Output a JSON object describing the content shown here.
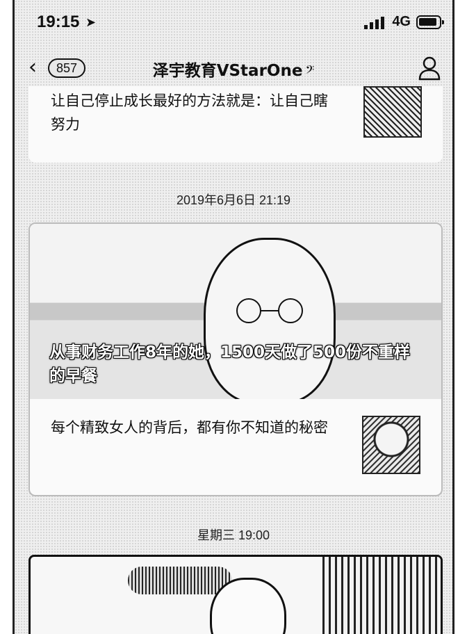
{
  "status_bar": {
    "time": "19:15",
    "network": "4G",
    "location_icon": "location-arrow-icon"
  },
  "nav": {
    "badge_count": "857",
    "title": "泽宇教育VStarOne",
    "title_icon": "ear-icon",
    "back_icon": "chevron-left-icon",
    "profile_icon": "user-icon"
  },
  "messages": [
    {
      "text": "让自己停止成长最好的方法就是：让自己瞎努力"
    },
    {
      "timestamp": "2019年6月6日 21:19",
      "headline": "从事财务工作8年的她，1500天做了500份不重样的早餐",
      "sub_text": "每个精致女人的背后，都有你不知道的秘密"
    },
    {
      "timestamp": "星期三 19:00"
    }
  ]
}
